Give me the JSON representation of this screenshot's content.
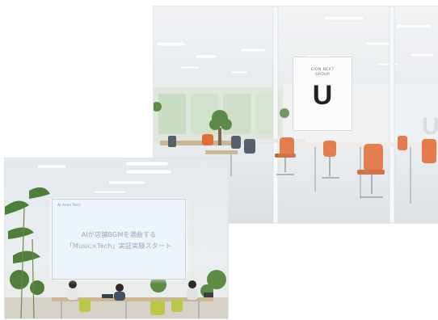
{
  "photos": [
    {
      "name": "office-photo",
      "sign": {
        "line1": "EION NEXT",
        "line2": "GROUP",
        "letter": "U"
      },
      "side_letter": "U"
    },
    {
      "name": "presentation-photo",
      "screen": {
        "brand": "AI Aeon Tech",
        "title_line1": "AIが店舗BGMを選曲する",
        "title_line2": "「Music×Tech」実証実験スタート"
      }
    }
  ]
}
